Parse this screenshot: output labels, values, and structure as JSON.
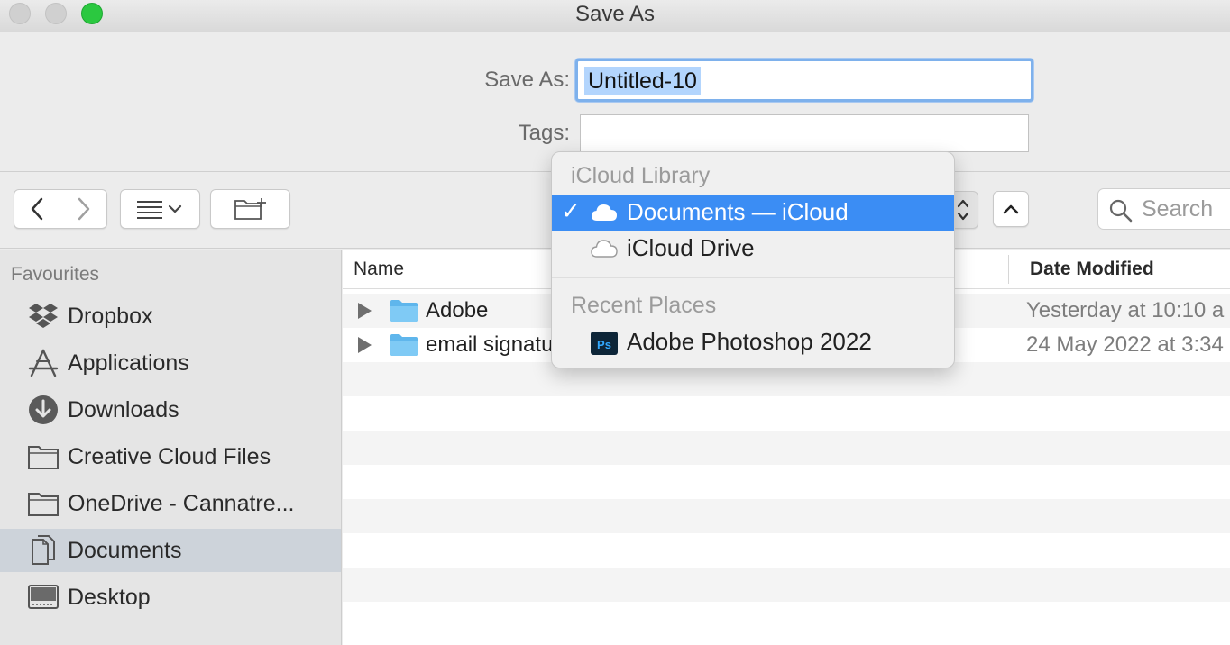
{
  "window": {
    "title": "Save As"
  },
  "form": {
    "save_as_label": "Save As:",
    "file_name": "Untitled-10",
    "tags_label": "Tags:",
    "tags_value": ""
  },
  "toolbar": {
    "search_placeholder": "Search"
  },
  "sidebar": {
    "heading": "Favourites",
    "items": [
      {
        "label": "Dropbox",
        "icon": "dropbox-icon"
      },
      {
        "label": "Applications",
        "icon": "applications-icon"
      },
      {
        "label": "Downloads",
        "icon": "downloads-icon"
      },
      {
        "label": "Creative Cloud Files",
        "icon": "folder-icon"
      },
      {
        "label": "OneDrive - Cannatre...",
        "icon": "folder-icon"
      },
      {
        "label": "Documents",
        "icon": "documents-icon",
        "selected": true
      },
      {
        "label": "Desktop",
        "icon": "desktop-icon"
      }
    ]
  },
  "filelist": {
    "columns": {
      "name": "Name",
      "date_modified": "Date Modified"
    },
    "rows": [
      {
        "name": "Adobe",
        "date": "Yesterday at 10:10 a"
      },
      {
        "name": "email signatu",
        "date": "24 May 2022 at 3:34"
      }
    ]
  },
  "location_popup": {
    "sections": [
      {
        "heading": "iCloud Library",
        "items": [
          {
            "label": "Documents — iCloud",
            "icon": "cloud-icon",
            "selected": true
          },
          {
            "label": "iCloud Drive",
            "icon": "cloud-icon"
          }
        ]
      },
      {
        "heading": "Recent Places",
        "items": [
          {
            "label": "Adobe Photoshop 2022",
            "icon": "photoshop-icon",
            "badge": "Ps"
          }
        ]
      }
    ]
  },
  "colors": {
    "accent": "#3b8df4",
    "selection_text_bg": "#b3d5fd",
    "folder_blue": "#6cc0f0",
    "zoom_green": "#2bc840"
  }
}
